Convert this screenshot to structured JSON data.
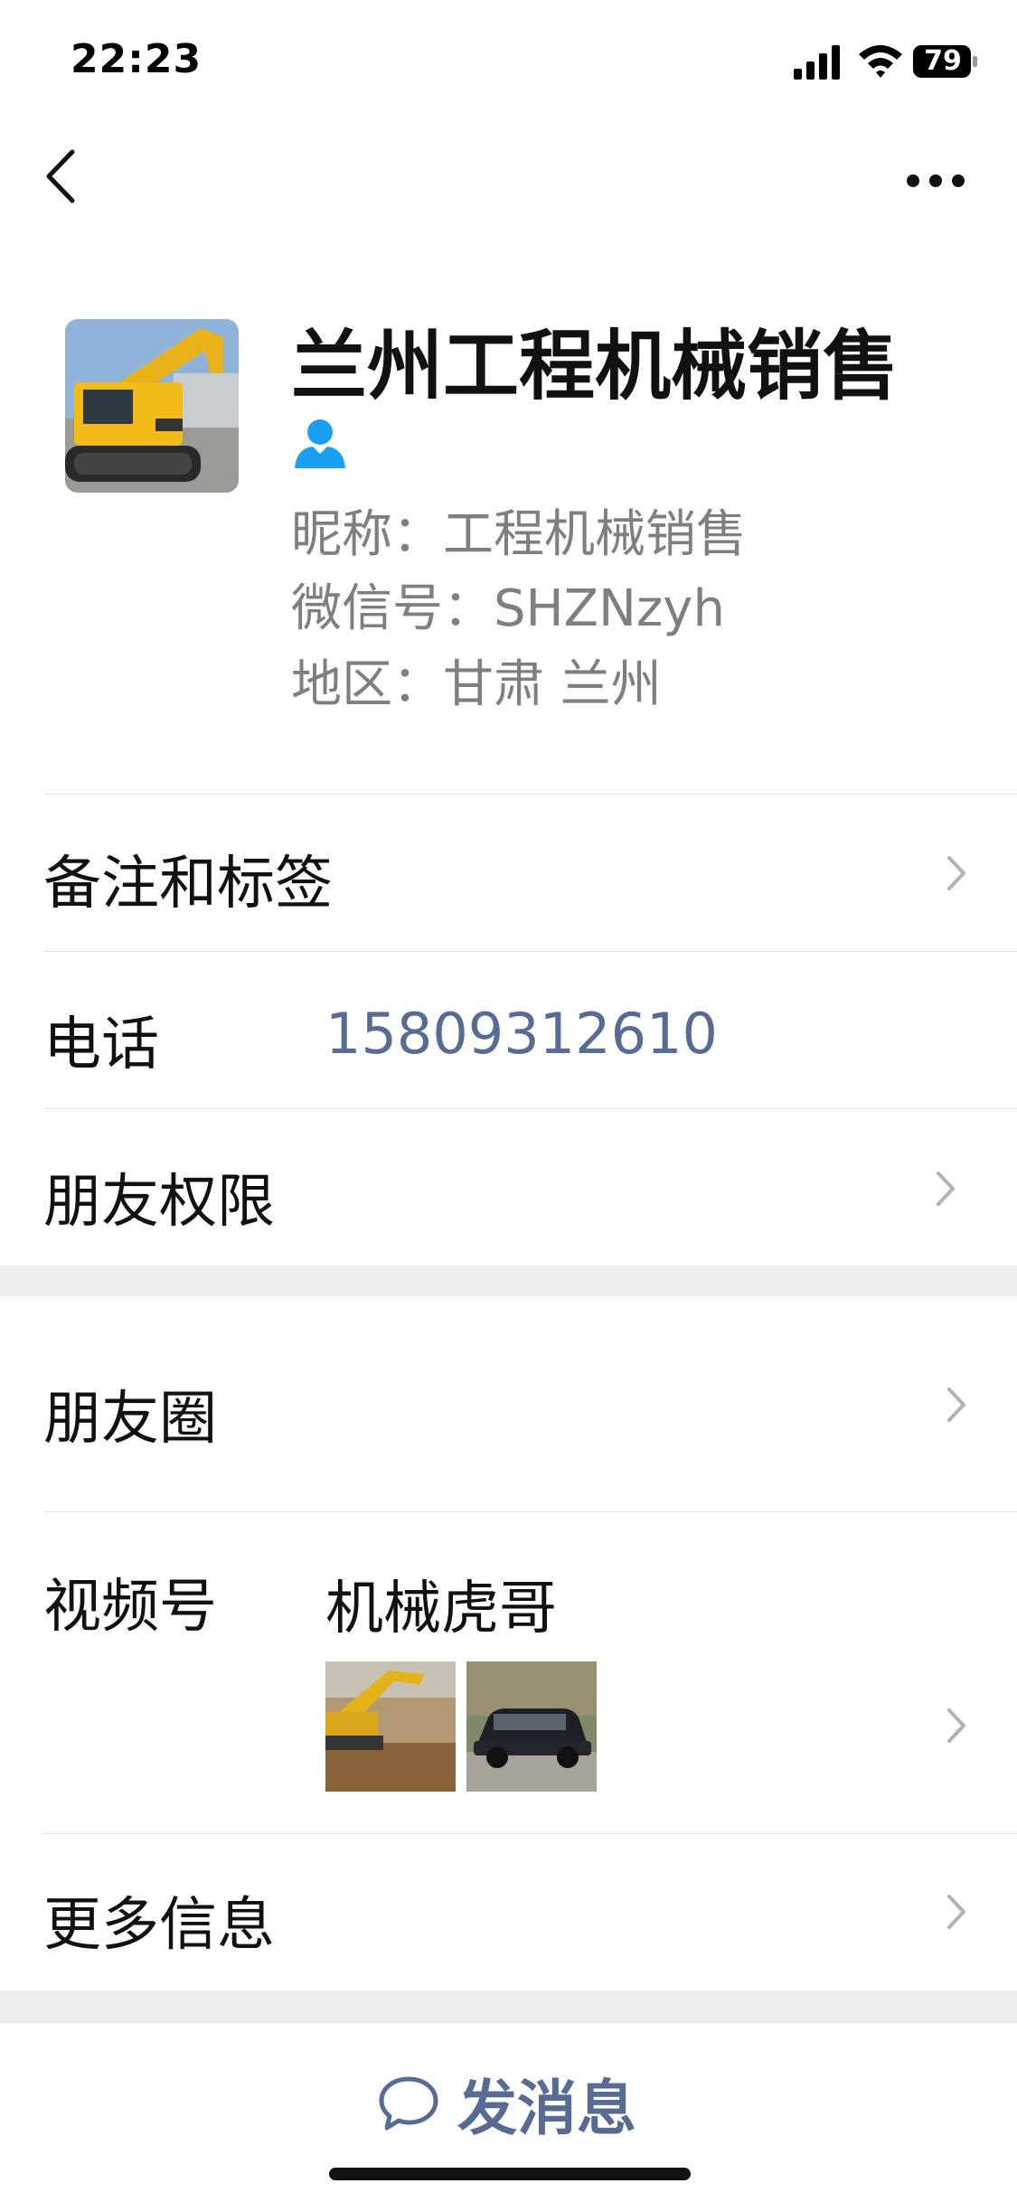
{
  "status_bar": {
    "time": "22:23",
    "battery": "79"
  },
  "profile": {
    "name": "兰州工程机械销售",
    "nickname": "昵称：工程机械销售",
    "wechat_id": "微信号：SHZNzyh",
    "region": "地区：甘肃 兰州"
  },
  "rows": {
    "remarks": "备注和标签",
    "phone_label": "电话",
    "phone_value": "15809312610",
    "permissions": "朋友权限",
    "moments": "朋友圈",
    "channels_label": "视频号",
    "channels_name": "机械虎哥",
    "more_info": "更多信息"
  },
  "actions": {
    "send_message": "发消息"
  },
  "colors": {
    "link": "#576b95",
    "accent_icon": "#1aa0f0",
    "background": "#ededed"
  },
  "icons": [
    "back-arrow-icon",
    "more-icon",
    "user-icon",
    "chevron-right-icon",
    "chat-bubble-icon"
  ]
}
